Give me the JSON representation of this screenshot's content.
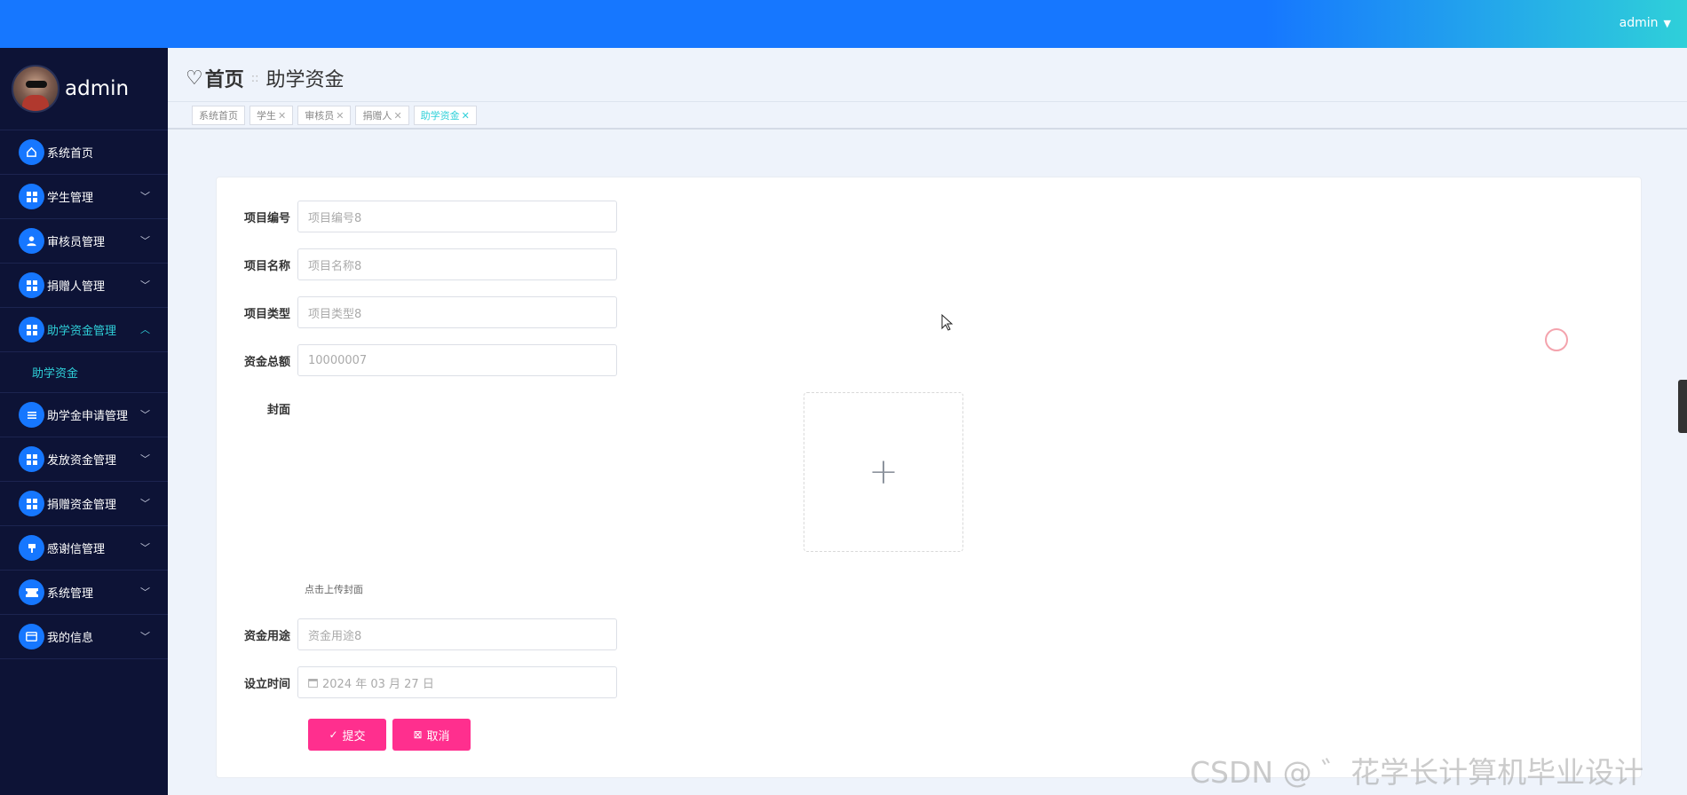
{
  "topbar": {
    "user": "admin"
  },
  "sidebar": {
    "profile_name": "admin",
    "items": [
      {
        "label": "系统首页",
        "icon": "home-icon"
      },
      {
        "label": "学生管理",
        "icon": "grid-icon"
      },
      {
        "label": "审核员管理",
        "icon": "user-icon"
      },
      {
        "label": "捐赠人管理",
        "icon": "grid-icon"
      },
      {
        "label": "助学资金管理",
        "icon": "grid-icon"
      },
      {
        "label": "助学金申请管理",
        "icon": "list-icon"
      },
      {
        "label": "发放资金管理",
        "icon": "grid-icon"
      },
      {
        "label": "捐赠资金管理",
        "icon": "grid-icon"
      },
      {
        "label": "感谢信管理",
        "icon": "pin-icon"
      },
      {
        "label": "系统管理",
        "icon": "ticket-icon"
      },
      {
        "label": "我的信息",
        "icon": "card-icon"
      }
    ],
    "submenu": {
      "label": "助学资金"
    }
  },
  "breadcrumb": {
    "home": "首页",
    "separator": "::",
    "current": "助学资金"
  },
  "tags": [
    {
      "label": "系统首页"
    },
    {
      "label": "学生"
    },
    {
      "label": "审核员"
    },
    {
      "label": "捐赠人"
    },
    {
      "label": "助学资金"
    }
  ],
  "form": {
    "fields": [
      {
        "label": "项目编号",
        "placeholder": "项目编号8"
      },
      {
        "label": "项目名称",
        "placeholder": "项目名称8"
      },
      {
        "label": "项目类型",
        "placeholder": "项目类型8"
      },
      {
        "label": "资金总额",
        "value": "10000007"
      }
    ],
    "cover_label": "封面",
    "cover_hint": "点击上传封面",
    "usage": {
      "label": "资金用途",
      "placeholder": "资金用途8"
    },
    "date": {
      "label": "设立时间",
      "value": "2024 年 03 月 27 日"
    },
    "submit": "提交",
    "cancel": "取消"
  },
  "watermark": "CSDN @ ゛花学长计算机毕业设计",
  "colors": {
    "primary": "#1677ff",
    "accent": "#2fd0d9",
    "button": "#ff2f8e",
    "sidebar": "#0d1336"
  }
}
